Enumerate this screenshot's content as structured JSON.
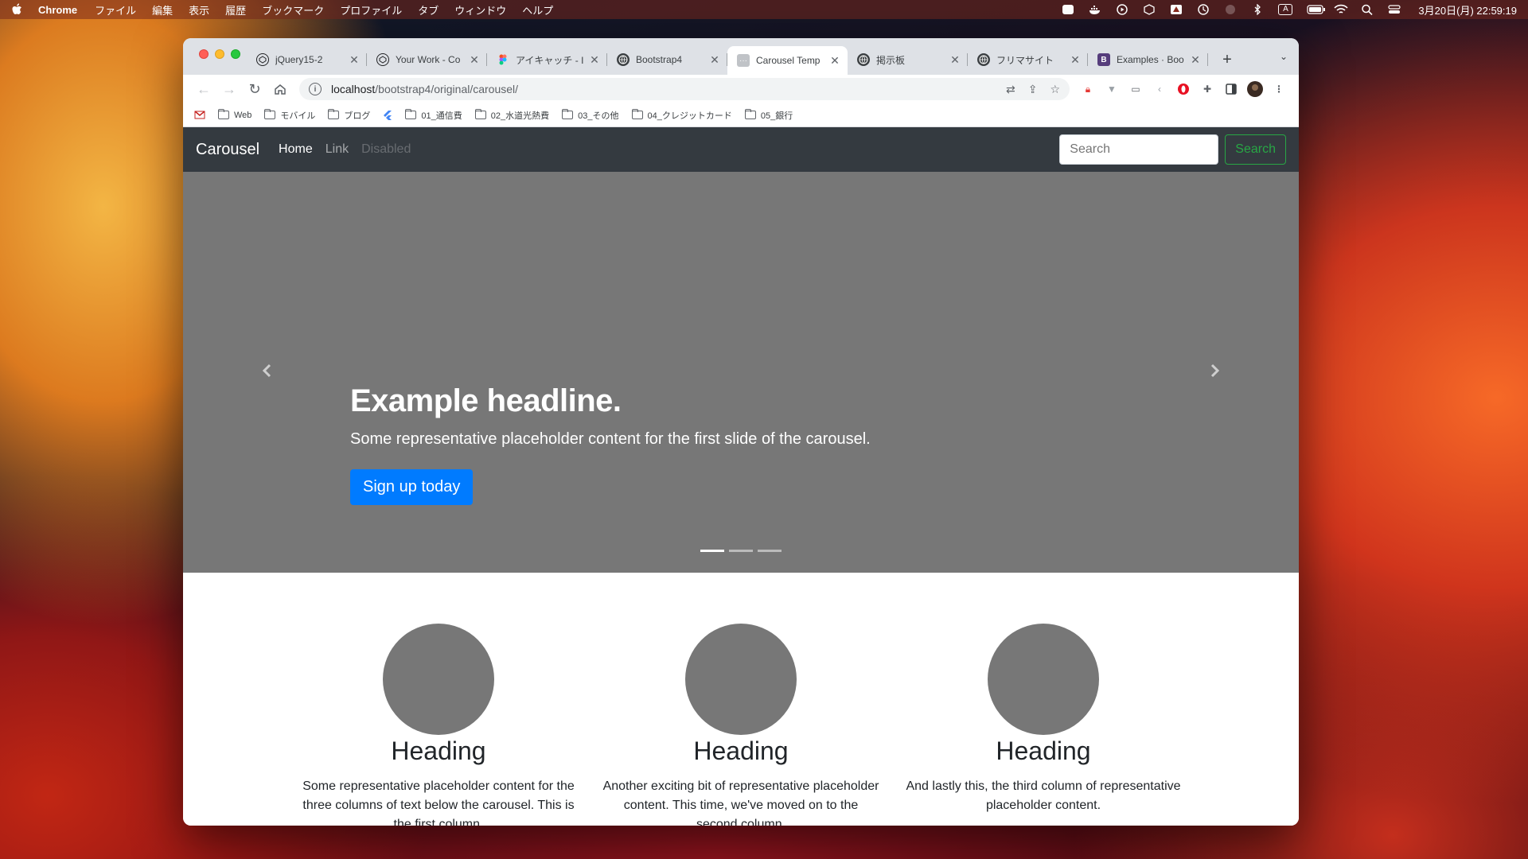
{
  "menubar": {
    "app_name": "Chrome",
    "items": [
      "ファイル",
      "編集",
      "表示",
      "履歴",
      "ブックマーク",
      "プロファイル",
      "タブ",
      "ウィンドウ",
      "ヘルプ"
    ],
    "clock": "3月20日(月)  22:59:19",
    "input_indicator": "A"
  },
  "tabs": [
    {
      "title": "jQuery15-2",
      "favicon_color": "#202124"
    },
    {
      "title": "Your Work - Co",
      "favicon_color": "#202124"
    },
    {
      "title": "アイキャッチ - I",
      "favicon_color": "#a259ff"
    },
    {
      "title": "Bootstrap4",
      "favicon_color": "#3c4043"
    },
    {
      "title": "Carousel Temp",
      "favicon_color": "#c0c3c7"
    },
    {
      "title": "掲示板",
      "favicon_color": "#3c4043"
    },
    {
      "title": "フリマサイト",
      "favicon_color": "#3c4043"
    },
    {
      "title": "Examples · Boo",
      "favicon_color": "#563d7c",
      "favicon_letter": "B"
    }
  ],
  "active_tab_index": 4,
  "address": {
    "host": "localhost",
    "path": "/bootstrap4/original/carousel/"
  },
  "bookmarks": [
    "Web",
    "モバイル",
    "ブログ",
    "01_通信費",
    "02_水道光熱費",
    "03_その他",
    "04_クレジットカード",
    "05_銀行"
  ],
  "site": {
    "brand": "Carousel",
    "nav": {
      "home": "Home",
      "link": "Link",
      "disabled": "Disabled"
    },
    "search_placeholder": "Search",
    "search_button": "Search"
  },
  "carousel": {
    "headline": "Example headline.",
    "text": "Some representative placeholder content for the first slide of the carousel.",
    "cta": "Sign up today",
    "slides": 3,
    "active_slide": 1
  },
  "columns": [
    {
      "heading": "Heading",
      "text": "Some representative placeholder content for the three columns of text below the carousel. This is the first column."
    },
    {
      "heading": "Heading",
      "text": "Another exciting bit of representative placeholder content. This time, we've moved on to the second column."
    },
    {
      "heading": "Heading",
      "text": "And lastly this, the third column of representative placeholder content."
    }
  ],
  "colors": {
    "navbar_bg": "#343a40",
    "primary": "#007bff",
    "success": "#28a745",
    "placeholder_gray": "#777777"
  }
}
